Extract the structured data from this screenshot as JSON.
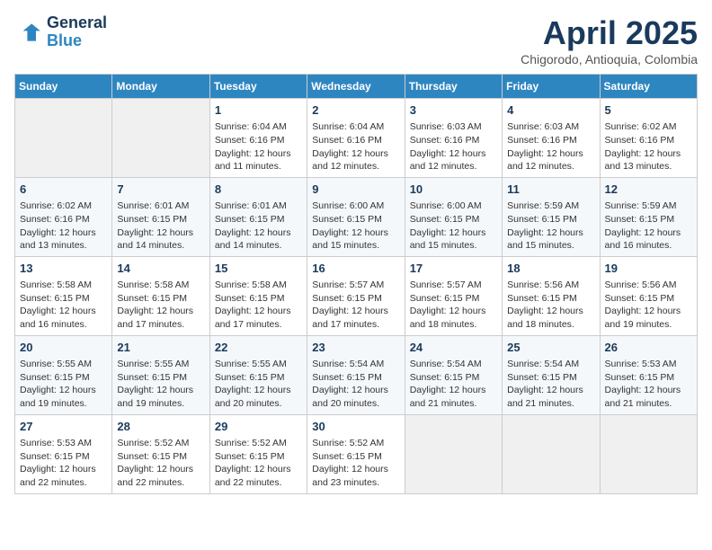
{
  "header": {
    "logo_line1": "General",
    "logo_line2": "Blue",
    "month": "April 2025",
    "location": "Chigorodo, Antioquia, Colombia"
  },
  "days_of_week": [
    "Sunday",
    "Monday",
    "Tuesday",
    "Wednesday",
    "Thursday",
    "Friday",
    "Saturday"
  ],
  "weeks": [
    [
      {
        "day": "",
        "info": ""
      },
      {
        "day": "",
        "info": ""
      },
      {
        "day": "1",
        "info": "Sunrise: 6:04 AM\nSunset: 6:16 PM\nDaylight: 12 hours\nand 11 minutes."
      },
      {
        "day": "2",
        "info": "Sunrise: 6:04 AM\nSunset: 6:16 PM\nDaylight: 12 hours\nand 12 minutes."
      },
      {
        "day": "3",
        "info": "Sunrise: 6:03 AM\nSunset: 6:16 PM\nDaylight: 12 hours\nand 12 minutes."
      },
      {
        "day": "4",
        "info": "Sunrise: 6:03 AM\nSunset: 6:16 PM\nDaylight: 12 hours\nand 12 minutes."
      },
      {
        "day": "5",
        "info": "Sunrise: 6:02 AM\nSunset: 6:16 PM\nDaylight: 12 hours\nand 13 minutes."
      }
    ],
    [
      {
        "day": "6",
        "info": "Sunrise: 6:02 AM\nSunset: 6:16 PM\nDaylight: 12 hours\nand 13 minutes."
      },
      {
        "day": "7",
        "info": "Sunrise: 6:01 AM\nSunset: 6:15 PM\nDaylight: 12 hours\nand 14 minutes."
      },
      {
        "day": "8",
        "info": "Sunrise: 6:01 AM\nSunset: 6:15 PM\nDaylight: 12 hours\nand 14 minutes."
      },
      {
        "day": "9",
        "info": "Sunrise: 6:00 AM\nSunset: 6:15 PM\nDaylight: 12 hours\nand 15 minutes."
      },
      {
        "day": "10",
        "info": "Sunrise: 6:00 AM\nSunset: 6:15 PM\nDaylight: 12 hours\nand 15 minutes."
      },
      {
        "day": "11",
        "info": "Sunrise: 5:59 AM\nSunset: 6:15 PM\nDaylight: 12 hours\nand 15 minutes."
      },
      {
        "day": "12",
        "info": "Sunrise: 5:59 AM\nSunset: 6:15 PM\nDaylight: 12 hours\nand 16 minutes."
      }
    ],
    [
      {
        "day": "13",
        "info": "Sunrise: 5:58 AM\nSunset: 6:15 PM\nDaylight: 12 hours\nand 16 minutes."
      },
      {
        "day": "14",
        "info": "Sunrise: 5:58 AM\nSunset: 6:15 PM\nDaylight: 12 hours\nand 17 minutes."
      },
      {
        "day": "15",
        "info": "Sunrise: 5:58 AM\nSunset: 6:15 PM\nDaylight: 12 hours\nand 17 minutes."
      },
      {
        "day": "16",
        "info": "Sunrise: 5:57 AM\nSunset: 6:15 PM\nDaylight: 12 hours\nand 17 minutes."
      },
      {
        "day": "17",
        "info": "Sunrise: 5:57 AM\nSunset: 6:15 PM\nDaylight: 12 hours\nand 18 minutes."
      },
      {
        "day": "18",
        "info": "Sunrise: 5:56 AM\nSunset: 6:15 PM\nDaylight: 12 hours\nand 18 minutes."
      },
      {
        "day": "19",
        "info": "Sunrise: 5:56 AM\nSunset: 6:15 PM\nDaylight: 12 hours\nand 19 minutes."
      }
    ],
    [
      {
        "day": "20",
        "info": "Sunrise: 5:55 AM\nSunset: 6:15 PM\nDaylight: 12 hours\nand 19 minutes."
      },
      {
        "day": "21",
        "info": "Sunrise: 5:55 AM\nSunset: 6:15 PM\nDaylight: 12 hours\nand 19 minutes."
      },
      {
        "day": "22",
        "info": "Sunrise: 5:55 AM\nSunset: 6:15 PM\nDaylight: 12 hours\nand 20 minutes."
      },
      {
        "day": "23",
        "info": "Sunrise: 5:54 AM\nSunset: 6:15 PM\nDaylight: 12 hours\nand 20 minutes."
      },
      {
        "day": "24",
        "info": "Sunrise: 5:54 AM\nSunset: 6:15 PM\nDaylight: 12 hours\nand 21 minutes."
      },
      {
        "day": "25",
        "info": "Sunrise: 5:54 AM\nSunset: 6:15 PM\nDaylight: 12 hours\nand 21 minutes."
      },
      {
        "day": "26",
        "info": "Sunrise: 5:53 AM\nSunset: 6:15 PM\nDaylight: 12 hours\nand 21 minutes."
      }
    ],
    [
      {
        "day": "27",
        "info": "Sunrise: 5:53 AM\nSunset: 6:15 PM\nDaylight: 12 hours\nand 22 minutes."
      },
      {
        "day": "28",
        "info": "Sunrise: 5:52 AM\nSunset: 6:15 PM\nDaylight: 12 hours\nand 22 minutes."
      },
      {
        "day": "29",
        "info": "Sunrise: 5:52 AM\nSunset: 6:15 PM\nDaylight: 12 hours\nand 22 minutes."
      },
      {
        "day": "30",
        "info": "Sunrise: 5:52 AM\nSunset: 6:15 PM\nDaylight: 12 hours\nand 23 minutes."
      },
      {
        "day": "",
        "info": ""
      },
      {
        "day": "",
        "info": ""
      },
      {
        "day": "",
        "info": ""
      }
    ]
  ]
}
